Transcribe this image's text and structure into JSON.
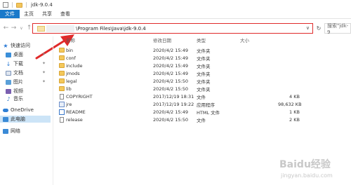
{
  "window": {
    "title": "jdk-9.0.4"
  },
  "ribbon": {
    "tabs": [
      "文件",
      "主页",
      "共享",
      "查看"
    ],
    "active": 0
  },
  "address": {
    "path": "\\Program Files\\Java\\jdk-9.0.4",
    "chevron": "∨"
  },
  "search": {
    "placeholder": "搜索\"jdk-9"
  },
  "sidebar": {
    "items": [
      {
        "label": "快速访问",
        "icon": "star-icon",
        "pinned": false
      },
      {
        "label": "桌面",
        "icon": "desktop-icon",
        "pinned": true
      },
      {
        "label": "下载",
        "icon": "download-icon",
        "pinned": true
      },
      {
        "label": "文档",
        "icon": "document-icon",
        "pinned": true
      },
      {
        "label": "图片",
        "icon": "picture-icon",
        "pinned": true
      },
      {
        "label": "视频",
        "icon": "video-icon",
        "pinned": false
      },
      {
        "label": "音乐",
        "icon": "music-icon",
        "pinned": false
      },
      {
        "label": "OneDrive",
        "icon": "cloud-icon",
        "pinned": false
      },
      {
        "label": "此电脑",
        "icon": "computer-icon",
        "pinned": false
      },
      {
        "label": "网络",
        "icon": "network-icon",
        "pinned": false
      }
    ]
  },
  "columns": {
    "name": "名称",
    "modified": "修改日期",
    "type": "类型",
    "size": "大小"
  },
  "files": [
    {
      "name": "bin",
      "modified": "2020/4/2 15:49",
      "type": "文件夹",
      "size": "",
      "kind": "folder"
    },
    {
      "name": "conf",
      "modified": "2020/4/2 15:49",
      "type": "文件夹",
      "size": "",
      "kind": "folder"
    },
    {
      "name": "include",
      "modified": "2020/4/2 15:49",
      "type": "文件夹",
      "size": "",
      "kind": "folder"
    },
    {
      "name": "jmods",
      "modified": "2020/4/2 15:49",
      "type": "文件夹",
      "size": "",
      "kind": "folder"
    },
    {
      "name": "legal",
      "modified": "2020/4/2 15:50",
      "type": "文件夹",
      "size": "",
      "kind": "folder"
    },
    {
      "name": "lib",
      "modified": "2020/4/2 15:50",
      "type": "文件夹",
      "size": "",
      "kind": "folder"
    },
    {
      "name": "COPYRIGHT",
      "modified": "2017/12/19 18:31",
      "type": "文件",
      "size": "4 KB",
      "kind": "doc"
    },
    {
      "name": "jre",
      "modified": "2017/12/19 19:22",
      "type": "应用程序",
      "size": "98,632 KB",
      "kind": "exe"
    },
    {
      "name": "README",
      "modified": "2020/4/2 15:49",
      "type": "HTML 文件",
      "size": "1 KB",
      "kind": "html"
    },
    {
      "name": "release",
      "modified": "2020/4/2 15:50",
      "type": "文件",
      "size": "2 KB",
      "kind": "doc"
    }
  ],
  "watermark": {
    "logo": "Baidu经验",
    "sub": "jingyan.baidu.com"
  },
  "colors": {
    "accent": "#1979ca",
    "highlight": "#e02a2a",
    "folder": "#f4c85a"
  }
}
